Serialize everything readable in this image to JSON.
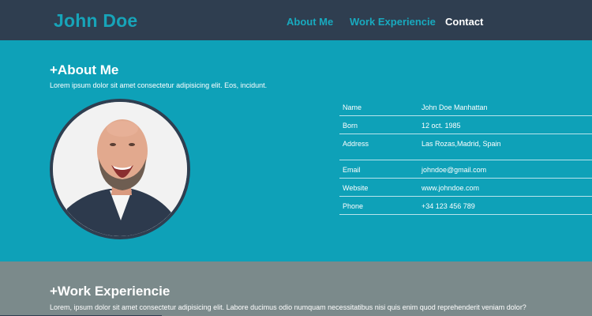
{
  "header": {
    "brand": "John Doe",
    "nav": [
      {
        "label": "About Me",
        "active": false
      },
      {
        "label": "Work Experiencie",
        "active": false
      },
      {
        "label": "Contact",
        "active": true
      }
    ]
  },
  "about": {
    "title": "+About Me",
    "description": "Lorem ipsum dolor sit amet consectetur adipisicing elit. Eos, incidunt.",
    "info": [
      {
        "label": "Name",
        "value": "John Doe Manhattan"
      },
      {
        "label": "Born",
        "value": "12 oct. 1985"
      },
      {
        "label": "Address",
        "value": "Las Rozas,Madrid, Spain"
      },
      {
        "label": "Email",
        "value": "johndoe@gmail.com"
      },
      {
        "label": "Website",
        "value": "www.johndoe.com"
      },
      {
        "label": "Phone",
        "value": "+34 123 456 789"
      }
    ]
  },
  "work": {
    "title": "+Work Experiencie",
    "description": "Lorem, ipsum dolor sit amet consectetur adipisicing elit. Labore ducimus odio numquam necessitatibus nisi quis enim quod reprehenderit veniam dolor?"
  },
  "colors": {
    "header_bg": "#2f3e50",
    "accent": "#17a4b9",
    "about_bg": "#0ea1b8",
    "work_bg": "#7b8a8b"
  }
}
